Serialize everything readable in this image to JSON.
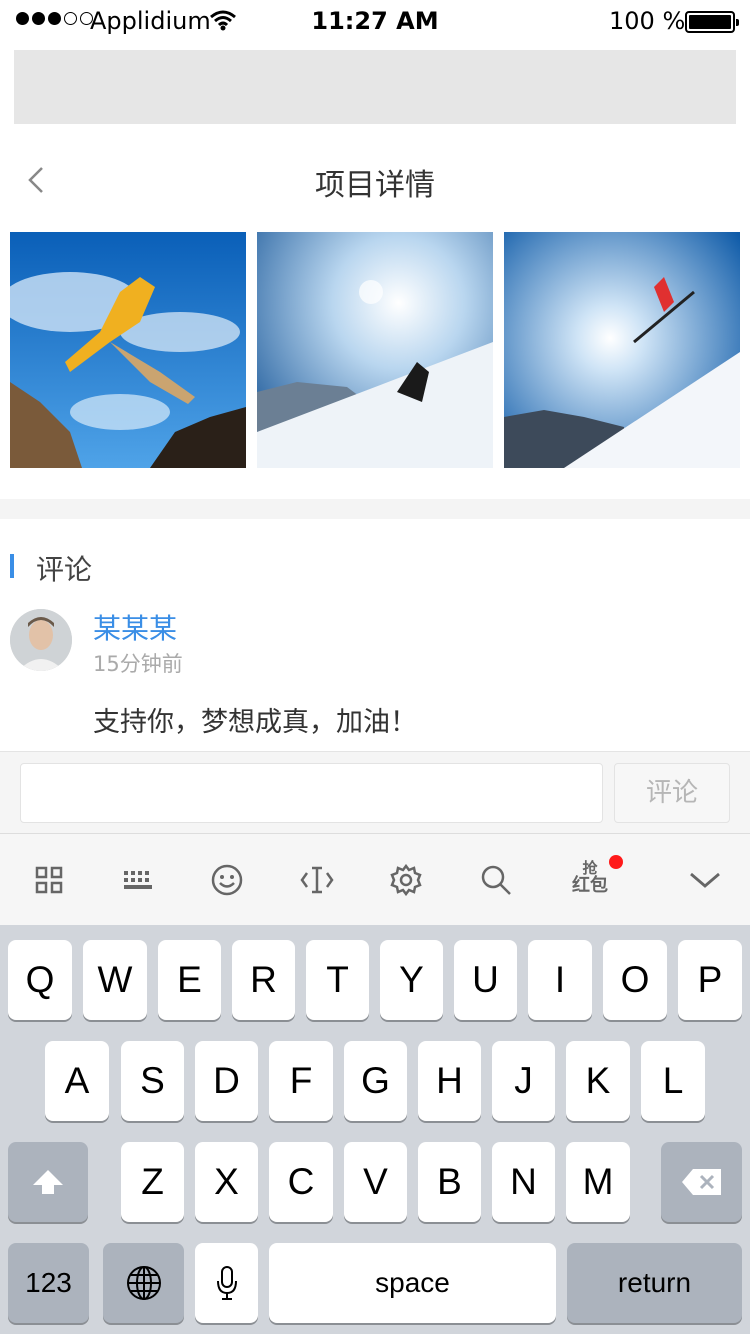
{
  "status_bar": {
    "carrier": "Applidium",
    "time": "11:27 AM",
    "battery": "100 %",
    "signal_dots_filled": 3,
    "signal_dots_total": 5
  },
  "nav": {
    "title": "项目详情",
    "back_icon": "chevron-left-icon"
  },
  "comments": {
    "section_title": "评论",
    "items": [
      {
        "user": "某某某",
        "time": "15分钟前",
        "text": "支持你，梦想成真，加油！"
      }
    ]
  },
  "comment_input": {
    "placeholder": "",
    "value": "",
    "send_label": "评论"
  },
  "keyboard_toolbar": {
    "icons": [
      "grid-icon",
      "keyboard-icon",
      "emoji-icon",
      "text-cursor-icon",
      "gear-icon",
      "search-icon",
      "red-packet-icon",
      "chevron-down-icon"
    ],
    "red_packet_line1": "抢",
    "red_packet_line2": "红包"
  },
  "keyboard": {
    "row1": [
      "Q",
      "W",
      "E",
      "R",
      "T",
      "Y",
      "U",
      "I",
      "O",
      "P"
    ],
    "row2": [
      "A",
      "S",
      "D",
      "F",
      "G",
      "H",
      "J",
      "K",
      "L"
    ],
    "row3": [
      "Z",
      "X",
      "C",
      "V",
      "B",
      "N",
      "M"
    ],
    "numbers_label": "123",
    "space_label": "space",
    "return_label": "return"
  },
  "colors": {
    "accent": "#3a8ee6",
    "keyboard_bg": "#d1d5db",
    "red_dot": "#ff1a1a"
  }
}
